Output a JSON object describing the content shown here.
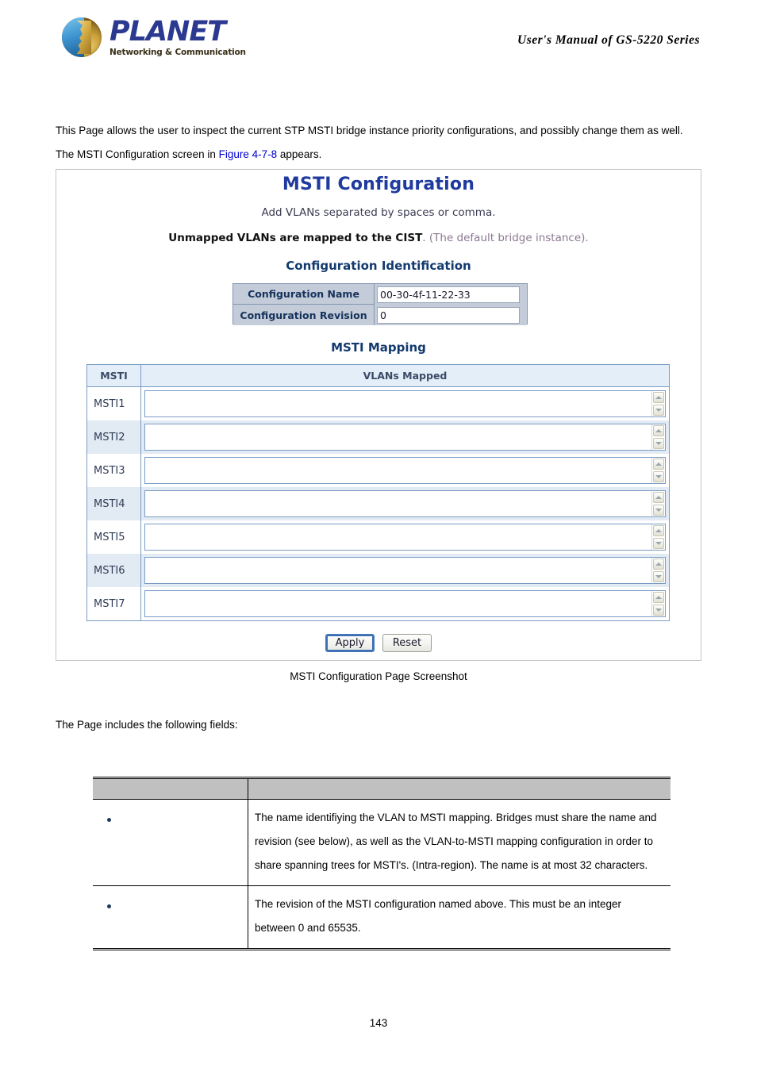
{
  "header": {
    "logo_name": "PLANET",
    "logo_tagline": "Networking & Communication",
    "manual_title": "User's Manual of GS-5220 Series"
  },
  "intro": {
    "part1": "This Page allows the user to inspect the current STP MSTI bridge instance priority configurations, and possibly change them as well. The MSTI Configuration screen in ",
    "figure_link": "Figure 4-7-8",
    "part2": " appears."
  },
  "screenshot": {
    "title": "MSTI Configuration",
    "subtitle_1": "Add VLANs separated by spaces or comma.",
    "subtitle_2_bold": "Unmapped VLANs are mapped to the CIST",
    "subtitle_2_rest": ". (The default bridge instance).",
    "section_config_identification": "Configuration Identification",
    "section_msti_mapping": "MSTI Mapping",
    "config_identification": {
      "rows": [
        {
          "label": "Configuration Name",
          "value": "00-30-4f-11-22-33"
        },
        {
          "label": "Configuration Revision",
          "value": "0"
        }
      ]
    },
    "mapping": {
      "col_msti": "MSTI",
      "col_vlans": "VLANs Mapped",
      "rows": [
        {
          "msti": "MSTI1",
          "vlans": ""
        },
        {
          "msti": "MSTI2",
          "vlans": ""
        },
        {
          "msti": "MSTI3",
          "vlans": ""
        },
        {
          "msti": "MSTI4",
          "vlans": ""
        },
        {
          "msti": "MSTI5",
          "vlans": ""
        },
        {
          "msti": "MSTI6",
          "vlans": ""
        },
        {
          "msti": "MSTI7",
          "vlans": ""
        }
      ]
    },
    "buttons": {
      "apply": "Apply",
      "reset": "Reset"
    },
    "colors": {
      "title_blue": "#1f3b9e",
      "section_blue": "#123a6e",
      "table_border": "#7a9cc4",
      "header_fill": "#e4eef9",
      "alt_row": "#e2eaf3",
      "label_fill": "#c3ccd8"
    }
  },
  "caption": "MSTI Configuration Page Screenshot",
  "follow_text": "The Page includes the following fields:",
  "fields_table": {
    "header": {
      "object": "",
      "description": ""
    },
    "rows": [
      {
        "object": "",
        "description": "The name identifiying the VLAN to MSTI mapping. Bridges must share the name and revision (see below), as well as the VLAN-to-MSTI mapping configuration in order to share spanning trees for MSTI's. (Intra-region). The name is at most 32 characters."
      },
      {
        "object": "",
        "description": "The revision of the MSTI configuration named above. This must be an integer between 0 and 65535."
      }
    ]
  },
  "page_number": "143"
}
